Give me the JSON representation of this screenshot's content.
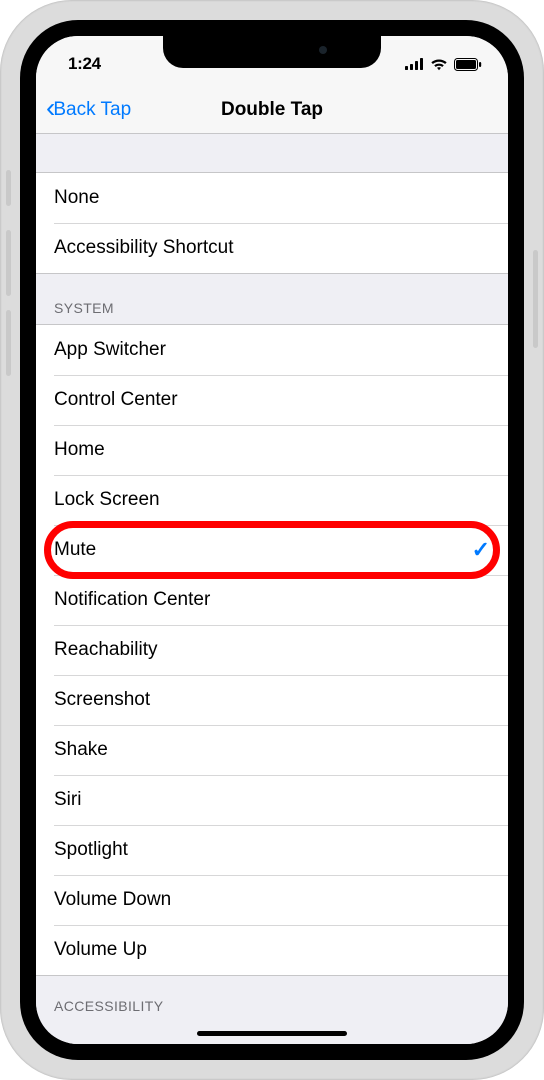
{
  "status": {
    "time": "1:24"
  },
  "nav": {
    "back_label": "Back Tap",
    "title": "Double Tap"
  },
  "sections": {
    "top": [
      {
        "label": "None",
        "selected": false
      },
      {
        "label": "Accessibility Shortcut",
        "selected": false
      }
    ],
    "system_header": "SYSTEM",
    "system": [
      {
        "label": "App Switcher",
        "selected": false
      },
      {
        "label": "Control Center",
        "selected": false
      },
      {
        "label": "Home",
        "selected": false
      },
      {
        "label": "Lock Screen",
        "selected": false
      },
      {
        "label": "Mute",
        "selected": true
      },
      {
        "label": "Notification Center",
        "selected": false
      },
      {
        "label": "Reachability",
        "selected": false
      },
      {
        "label": "Screenshot",
        "selected": false
      },
      {
        "label": "Shake",
        "selected": false
      },
      {
        "label": "Siri",
        "selected": false
      },
      {
        "label": "Spotlight",
        "selected": false
      },
      {
        "label": "Volume Down",
        "selected": false
      },
      {
        "label": "Volume Up",
        "selected": false
      }
    ],
    "accessibility_header": "ACCESSIBILITY"
  },
  "highlight": {
    "target": "Mute"
  }
}
